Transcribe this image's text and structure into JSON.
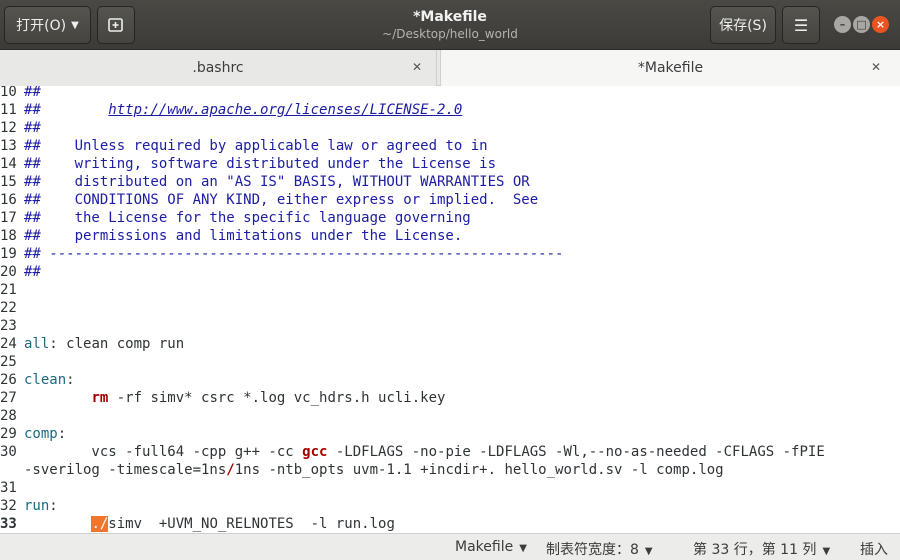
{
  "header": {
    "open_label": "打开(O)",
    "title": "*Makefile",
    "subtitle": "~/Desktop/hello_world",
    "save_label": "保存(S)"
  },
  "tabs": [
    {
      "label": ".bashrc",
      "active": false
    },
    {
      "label": "*Makefile",
      "active": true
    }
  ],
  "editor": {
    "lines": [
      {
        "num": "10",
        "segments": [
          {
            "t": "##",
            "c": "cmt"
          }
        ]
      },
      {
        "num": "11",
        "segments": [
          {
            "t": "##        ",
            "c": "cmt"
          },
          {
            "t": "http://www.apache.org/licenses/LICENSE-2.0",
            "c": "url"
          }
        ]
      },
      {
        "num": "12",
        "segments": [
          {
            "t": "##",
            "c": "cmt"
          }
        ]
      },
      {
        "num": "13",
        "segments": [
          {
            "t": "##    Unless required by applicable law or agreed to in",
            "c": "cmt"
          }
        ]
      },
      {
        "num": "14",
        "segments": [
          {
            "t": "##    writing, software distributed under the License is",
            "c": "cmt"
          }
        ]
      },
      {
        "num": "15",
        "segments": [
          {
            "t": "##    distributed on an \"AS IS\" BASIS, WITHOUT WARRANTIES OR",
            "c": "cmt"
          }
        ]
      },
      {
        "num": "16",
        "segments": [
          {
            "t": "##    CONDITIONS OF ANY KIND, either express or implied.  See",
            "c": "cmt"
          }
        ]
      },
      {
        "num": "17",
        "segments": [
          {
            "t": "##    the License for the specific language governing",
            "c": "cmt"
          }
        ]
      },
      {
        "num": "18",
        "segments": [
          {
            "t": "##    permissions and limitations under the License.",
            "c": "cmt"
          }
        ]
      },
      {
        "num": "19",
        "segments": [
          {
            "t": "## -------------------------------------------------------------",
            "c": "cmt"
          }
        ]
      },
      {
        "num": "20",
        "segments": [
          {
            "t": "##",
            "c": "cmt"
          }
        ]
      },
      {
        "num": "21",
        "segments": []
      },
      {
        "num": "22",
        "segments": []
      },
      {
        "num": "23",
        "segments": []
      },
      {
        "num": "24",
        "segments": [
          {
            "t": "all",
            "c": "tgt"
          },
          {
            "t": ": clean comp run",
            "c": ""
          }
        ]
      },
      {
        "num": "25",
        "segments": []
      },
      {
        "num": "26",
        "segments": [
          {
            "t": "clean",
            "c": "tgt"
          },
          {
            "t": ":",
            "c": ""
          }
        ]
      },
      {
        "num": "27",
        "segments": [
          {
            "t": "        ",
            "c": ""
          },
          {
            "t": "rm",
            "c": "kw"
          },
          {
            "t": " -rf simv* csrc *.log vc_hdrs.h ucli.key",
            "c": ""
          }
        ]
      },
      {
        "num": "28",
        "segments": []
      },
      {
        "num": "29",
        "segments": [
          {
            "t": "comp",
            "c": "tgt"
          },
          {
            "t": ":",
            "c": ""
          }
        ]
      },
      {
        "num": "30",
        "segments": [
          {
            "t": "        vcs -full64 -cpp g++ -cc ",
            "c": ""
          },
          {
            "t": "gcc",
            "c": "kw"
          },
          {
            "t": " -LDFLAGS -no-pie -LDFLAGS -Wl,--no-as-needed -CFLAGS -fPIE",
            "c": ""
          }
        ]
      },
      {
        "num": "",
        "segments": [
          {
            "t": "-sverilog -timescale=1ns",
            "c": ""
          },
          {
            "t": "/",
            "c": "sl"
          },
          {
            "t": "1ns -ntb_opts uvm-1.1 +incdir+. hello_world.sv -l comp.log",
            "c": ""
          }
        ]
      },
      {
        "num": "31",
        "segments": []
      },
      {
        "num": "32",
        "segments": [
          {
            "t": "run",
            "c": "tgt"
          },
          {
            "t": ":",
            "c": ""
          }
        ]
      },
      {
        "num": "33",
        "current": true,
        "segments": [
          {
            "t": "        ",
            "c": ""
          },
          {
            "t": "./",
            "c": "hl"
          },
          {
            "t": "simv  +UVM_NO_RELNOTES  -l run.log",
            "c": ""
          }
        ]
      }
    ]
  },
  "statusbar": {
    "language": "Makefile",
    "tab_width": "制表符宽度：8",
    "position": "第 33 行，第 11 列",
    "mode": "插入"
  }
}
